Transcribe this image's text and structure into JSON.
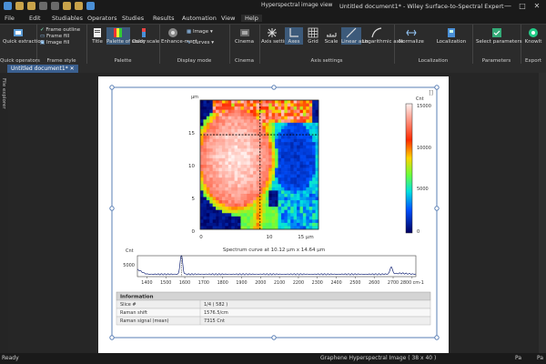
{
  "title_bar": {
    "window_title": "Untitled document1* - Wiley Surface-to-Spectral Expert",
    "context_tab": "Hyperspectral image view",
    "window_controls": [
      "—",
      "□",
      "✕"
    ]
  },
  "menu": [
    "File",
    "Edit",
    "Studiables",
    "Operators",
    "Studies",
    "Results",
    "Automation",
    "View",
    "Help"
  ],
  "ribbon": {
    "quick_operators": {
      "button": "Quick extraction",
      "group": "Quick operators"
    },
    "frame_style": {
      "items": [
        "Frame outline",
        "Frame fill",
        "Image fill"
      ],
      "group": "Frame style"
    },
    "palette": {
      "buttons": [
        "Title",
        "Palette of study",
        "Color scale"
      ],
      "group": "Palette"
    },
    "display_mode": {
      "buttons": [
        "Enhance-ment",
        "Image",
        "Curves"
      ],
      "group": "Display mode"
    },
    "cinema": {
      "button": "Cinema",
      "group": "Cinema"
    },
    "axis_settings": {
      "buttons": [
        "Axis settings",
        "Axes",
        "Grid",
        "Scale",
        "Linear axis",
        "Logarithmic axis"
      ],
      "group": "Axis settings"
    },
    "localization": {
      "buttons": [
        "Normalize",
        "Localization"
      ],
      "group": "Localization"
    },
    "parameters": {
      "button": "Select parameters",
      "group": "Parameters"
    },
    "export": {
      "buttons": [
        "KnowIt"
      ],
      "group": "Export"
    }
  },
  "document_tab": "Untitled document1*",
  "explorer_label": "File explorer",
  "colors": {
    "accent": "#4f8fd8",
    "ribbon_bg": "#2b2b2b",
    "chrome_bg": "#1a1a1a",
    "page_bg": "#ffffff"
  },
  "image_panel": {
    "y_unit": "μm",
    "x_unit": "μm",
    "x_ticks": [
      "0",
      "10",
      "15 μm"
    ],
    "y_ticks": [
      "15",
      "10",
      "5",
      "0"
    ],
    "colorbar_unit": "Cnt",
    "colorbar_ticks": [
      "15000",
      "10000",
      "5000",
      "0"
    ],
    "heatmap": {
      "type": "heatmap",
      "x_range_um": [
        0,
        20
      ],
      "y_range_um": [
        0,
        20
      ],
      "grid": [
        38,
        40
      ],
      "value_range": [
        0,
        15000
      ],
      "crosshair_um": {
        "x": 10.12,
        "y": 14.64
      }
    }
  },
  "spectrum": {
    "caption": "Spectrum curve at 10.12 μm x 14.64 μm",
    "y_unit": "Cnt",
    "y_tick": "5000",
    "x_ticks": [
      "1400",
      "1500",
      "1600",
      "1700",
      "1800",
      "1900",
      "2000",
      "2100",
      "2200",
      "2300",
      "2400",
      "2500",
      "2600",
      "2700",
      "2800 cm-1"
    ],
    "chart_data": {
      "type": "line",
      "xlabel": "",
      "ylabel": "Cnt",
      "xlim": [
        1350,
        2820
      ],
      "ylim": [
        0,
        7000
      ],
      "peaks": [
        {
          "x": 1582,
          "y": 6800
        },
        {
          "x": 2690,
          "y": 2400
        }
      ],
      "baseline": 800
    }
  },
  "info_table": {
    "header": "Information",
    "rows": [
      [
        "Slice #",
        "1/4 ( 582 )"
      ],
      [
        "Raman shift",
        "1576.5/cm"
      ],
      [
        "Raman signal (mean)",
        "7315 Cnt"
      ]
    ]
  },
  "status_bar": {
    "left": "Ready",
    "center": "Graphene Hyperspectral Image ( 38 x 40 )",
    "right1": "Pa",
    "right2": "Pa"
  }
}
